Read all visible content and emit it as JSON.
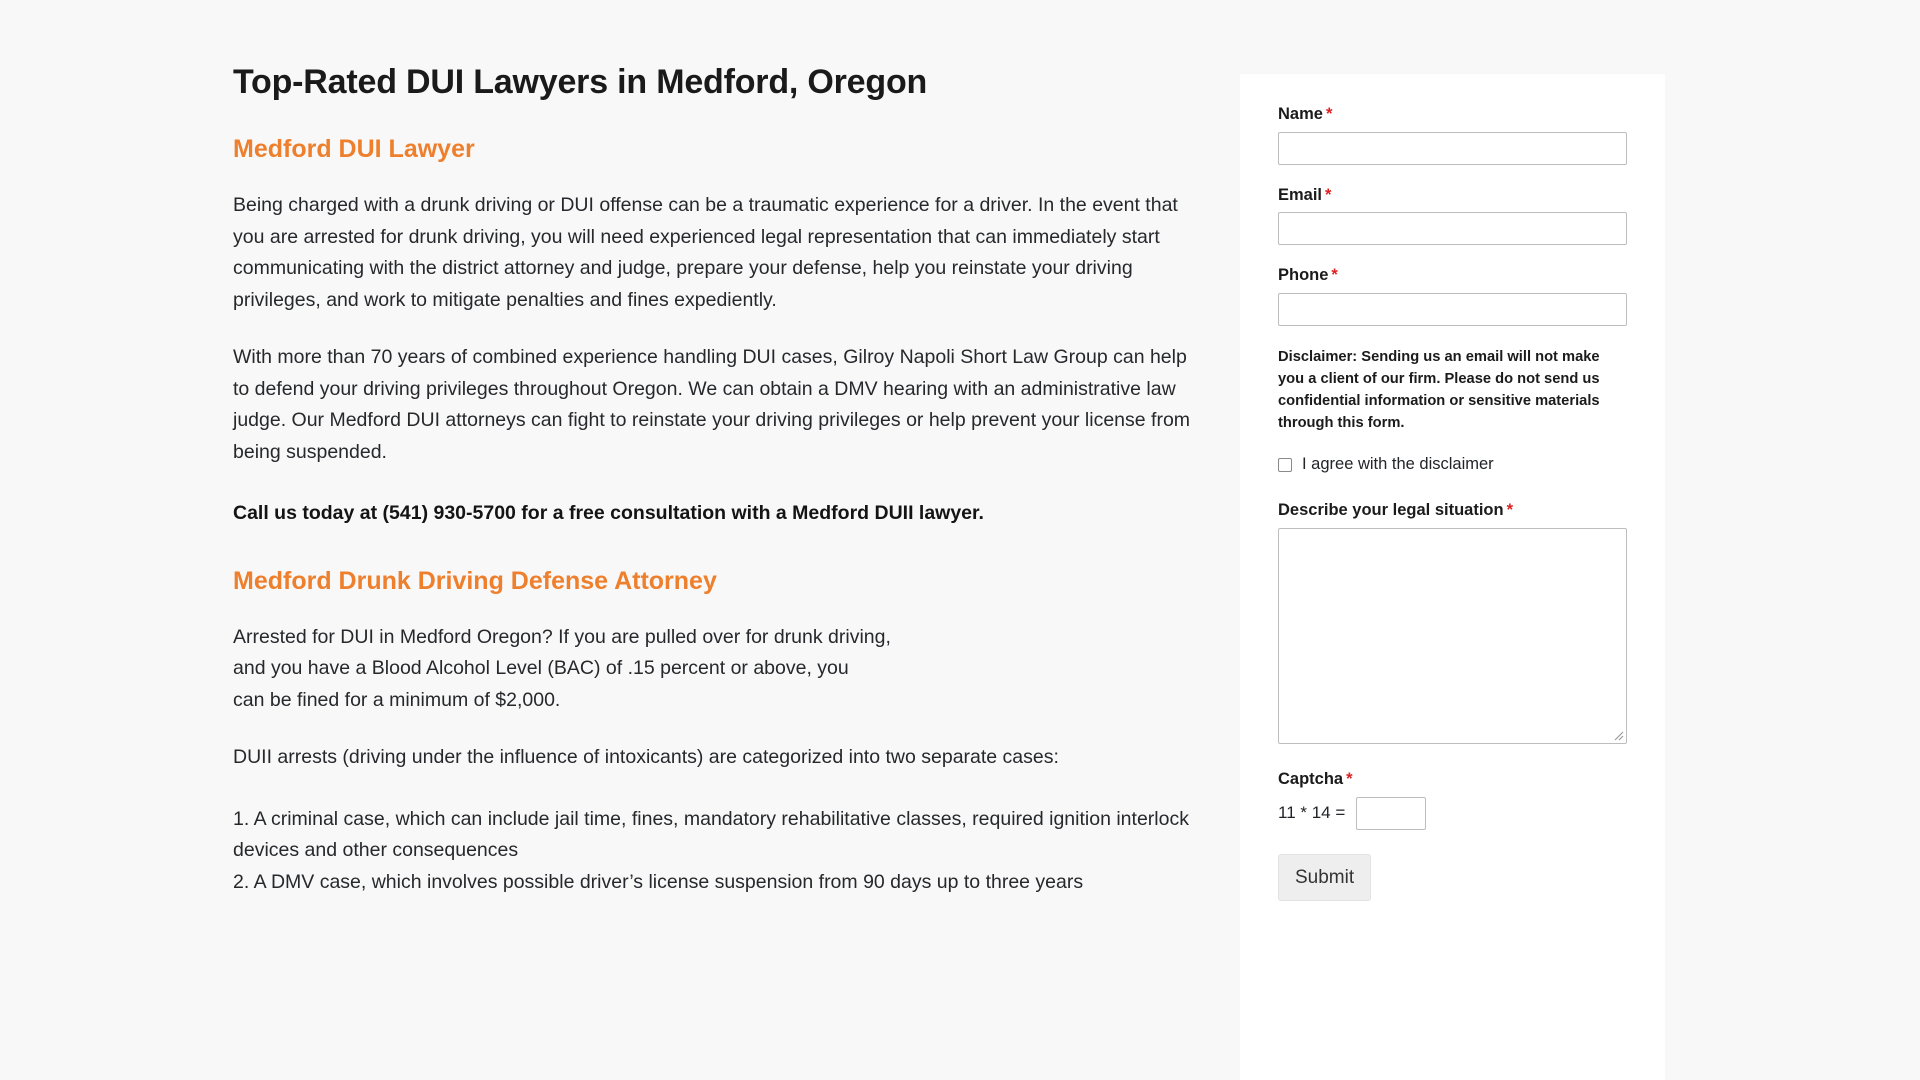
{
  "article": {
    "title": "Top-Rated DUI Lawyers in Medford, Oregon",
    "heading_1": "Medford DUI Lawyer",
    "paragraph_1": "Being charged with a drunk driving or DUI offense can be a traumatic experience for a driver. In the event that you are arrested for drunk driving, you will need experienced legal representation that can immediately start communicating with the district attorney and judge, prepare your defense, help you reinstate your driving privileges, and work to mitigate penalties and fines expediently.",
    "paragraph_2": "With more than 70 years of combined experience handling DUI cases, Gilroy Napoli Short Law Group can help to defend your driving privileges throughout Oregon. We can obtain a DMV hearing with an administrative law judge. Our Medford DUI attorneys can fight to reinstate your driving privileges or help prevent your license from being suspended.",
    "call_to_action": "Call us today at (541) 930-5700 for a free consultation with a Medford DUII lawyer.",
    "heading_2": "Medford Drunk Driving Defense Attorney",
    "paragraph_3_line_1": "Arrested for DUI in Medford Oregon? If you are pulled over for drunk driving,",
    "paragraph_3_line_2": "and you have a Blood Alcohol Level (BAC) of .15 percent or above, you",
    "paragraph_3_line_3": "can be fined for a minimum of $2,000.",
    "paragraph_4": "DUII arrests (driving under the influence of intoxicants) are categorized into two separate cases:",
    "list_item_1": "1. A criminal case, which can include jail time, fines, mandatory rehabilitative classes, required ignition interlock devices and other consequences",
    "list_item_2": "2. A DMV case, which involves possible driver’s license suspension from 90 days up to three years",
    "heading_color": "#ee7f2d",
    "body_color": "#26282b"
  },
  "contact_form": {
    "required_marker": "*",
    "name": {
      "label": "Name",
      "value": "",
      "placeholder": ""
    },
    "email": {
      "label": "Email",
      "value": "",
      "placeholder": ""
    },
    "phone": {
      "label": "Phone",
      "value": "",
      "placeholder": ""
    },
    "disclaimer_text": "Disclaimer: Sending us an email will not make you a client of our firm. Please do not send us confidential information or sensitive materials through this form.",
    "agree_checkbox": {
      "label": "I agree with the disclaimer",
      "checked": false
    },
    "situation": {
      "label": "Describe your legal situation",
      "value": "",
      "placeholder": ""
    },
    "captcha": {
      "label": "Captcha",
      "expression": "11 * 14 =",
      "value": "",
      "placeholder": ""
    },
    "submit_label": "Submit",
    "required_color": "#e02020"
  }
}
